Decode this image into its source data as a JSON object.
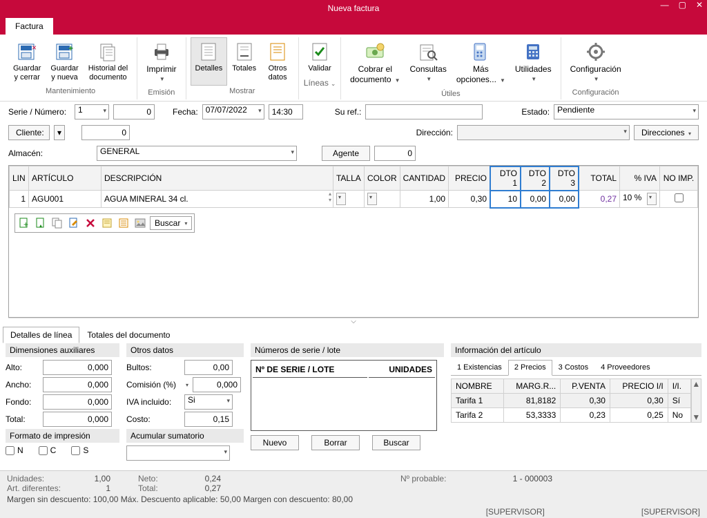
{
  "window": {
    "title": "Nueva factura"
  },
  "ribbon": {
    "tab": "Factura",
    "groups": {
      "mantenimiento": {
        "label": "Mantenimiento",
        "guardar_cerrar": "Guardar\ny cerrar",
        "guardar_nueva": "Guardar\ny nueva",
        "historial": "Historial del\ndocumento"
      },
      "emision": {
        "label": "Emisión",
        "imprimir": "Imprimir"
      },
      "mostrar": {
        "label": "Mostrar",
        "detalles": "Detalles",
        "totales": "Totales",
        "otros": "Otros\ndatos"
      },
      "lineas": {
        "label": "Líneas",
        "validar": "Validar"
      },
      "utiles": {
        "label": "Útiles",
        "cobrar": "Cobrar el\ndocumento",
        "consultas": "Consultas",
        "mas": "Más\nopciones...",
        "utilidades": "Utilidades"
      },
      "config": {
        "label": "Configuración",
        "config": "Configuración"
      }
    }
  },
  "form": {
    "serie_lbl": "Serie / Número:",
    "serie": "1",
    "numero": "0",
    "fecha_lbl": "Fecha:",
    "fecha": "07/07/2022",
    "hora": "14:30",
    "su_ref_lbl": "Su ref.:",
    "su_ref": "",
    "estado_lbl": "Estado:",
    "estado": "Pendiente",
    "cliente_lbl": "Cliente:",
    "cliente_num": "0",
    "direccion_lbl": "Dirección:",
    "direcciones_btn": "Direcciones",
    "almacen_lbl": "Almacén:",
    "almacen": "GENERAL",
    "agente_btn": "Agente",
    "agente_num": "0"
  },
  "grid": {
    "headers": {
      "lin": "LIN",
      "articulo": "ARTÍCULO",
      "descripcion": "DESCRIPCIÓN",
      "talla": "TALLA",
      "color": "COLOR",
      "cantidad": "CANTIDAD",
      "precio": "PRECIO",
      "dto1": "DTO 1",
      "dto2": "DTO 2",
      "dto3": "DTO 3",
      "total": "TOTAL",
      "pct_iva": "% IVA",
      "no_imp": "NO IMP."
    },
    "row": {
      "lin": "1",
      "articulo": "AGU001",
      "descripcion": "AGUA MINERAL 34 cl.",
      "cantidad": "1,00",
      "precio": "0,30",
      "dto1": "10",
      "dto2": "0,00",
      "dto3": "0,00",
      "total": "0,27",
      "pct_iva": "10 %"
    },
    "toolbar_search": "Buscar"
  },
  "lower_tabs": {
    "detalles": "Detalles de línea",
    "totales": "Totales del documento"
  },
  "dim": {
    "head": "Dimensiones auxiliares",
    "alto_lbl": "Alto:",
    "alto": "0,000",
    "ancho_lbl": "Ancho:",
    "ancho": "0,000",
    "fondo_lbl": "Fondo:",
    "fondo": "0,000",
    "total_lbl": "Total:",
    "total": "0,000",
    "formato_head": "Formato de impresión",
    "n": "N",
    "c": "C",
    "s": "S"
  },
  "otros": {
    "head": "Otros datos",
    "bultos_lbl": "Bultos:",
    "bultos": "0,00",
    "comision_lbl": "Comisión (%)",
    "comision": "0,000",
    "iva_lbl": "IVA incluido:",
    "iva": "Si",
    "costo_lbl": "Costo:",
    "costo": "0,15",
    "acum_head": "Acumular sumatorio"
  },
  "serie": {
    "head": "Números de serie / lote",
    "col1": "Nº DE SERIE / LOTE",
    "col2": "UNIDADES",
    "nuevo": "Nuevo",
    "borrar": "Borrar",
    "buscar": "Buscar"
  },
  "info": {
    "head": "Información del artículo",
    "t1": "1 Existencias",
    "t2": "2 Precios",
    "t3": "3 Costos",
    "t4": "4 Proveedores",
    "hdr": {
      "nombre": "NOMBRE",
      "marg": "MARG.R...",
      "pventa": "P.VENTA",
      "precioii": "PRECIO I/I",
      "ii": "I/I."
    },
    "rows": [
      {
        "nombre": "Tarifa 1",
        "marg": "81,8182",
        "pventa": "0,30",
        "precioii": "0,30",
        "ii": "Sí"
      },
      {
        "nombre": "Tarifa 2",
        "marg": "53,3333",
        "pventa": "0,23",
        "precioii": "0,25",
        "ii": "No"
      }
    ]
  },
  "status": {
    "unidades_lbl": "Unidades:",
    "unidades": "1,00",
    "neto_lbl": "Neto:",
    "neto": "0,24",
    "art_lbl": "Art. diferentes:",
    "art": "1",
    "total_lbl": "Total:",
    "total": "0,27",
    "nprob_lbl": "Nº probable:",
    "nprob": "1 - 000003",
    "line2": "Margen sin descuento: 100,00  Máx. Descuento aplicable: 50,00  Margen con descuento: 80,00",
    "user": "[SUPERVISOR]"
  }
}
